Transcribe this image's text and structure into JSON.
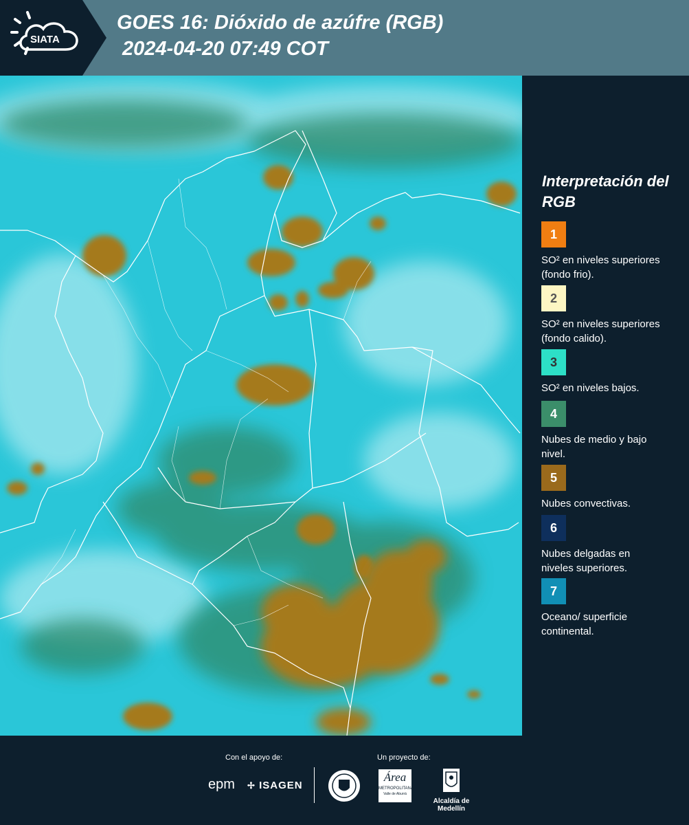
{
  "header": {
    "logo_text": "SIATA",
    "title_line1": "GOES 16: Dióxido de azúfre (RGB)",
    "title_line2": "2024-04-20 07:49 COT"
  },
  "legend": {
    "title": "Interpretación del RGB",
    "items": [
      {
        "number": "1",
        "color": "#f07e12",
        "text_color": "#ffffff",
        "label": "SO² en niveles superiores (fondo frio)."
      },
      {
        "number": "2",
        "color": "#fdf6c3",
        "text_color": "#555555",
        "label": "SO² en niveles superiores (fondo calido)."
      },
      {
        "number": "3",
        "color": "#2de0c7",
        "text_color": "#333333",
        "label": "SO² en niveles bajos."
      },
      {
        "number": "4",
        "color": "#3b8e6a",
        "text_color": "#ffffff",
        "label": "Nubes de medio y bajo nivel."
      },
      {
        "number": "5",
        "color": "#9a6a1c",
        "text_color": "#ffffff",
        "label": "Nubes convectivas."
      },
      {
        "number": "6",
        "color": "#0e2f5c",
        "text_color": "#ffffff",
        "label": "Nubes delgadas en niveles superiores."
      },
      {
        "number": "7",
        "color": "#118fb5",
        "text_color": "#ffffff",
        "label": "Oceano/ superficie continental."
      }
    ]
  },
  "footer": {
    "support_label": "Con el apoyo de:",
    "project_label": "Un proyecto de:",
    "epm": "epm",
    "isagen": "ISAGEN",
    "metropolitana_1": "Área",
    "metropolitana_2": "METROPOLITANA",
    "metropolitana_3": "Valle de Aburrá",
    "alcaldia": "Alcaldía de Medellín"
  },
  "map_colors": {
    "background": "#29c7d9",
    "cloud_light": "#9fe5ee",
    "green_cloud": "#3e8f5a",
    "convective": "#a0771e",
    "boundary": "#ffffff"
  }
}
